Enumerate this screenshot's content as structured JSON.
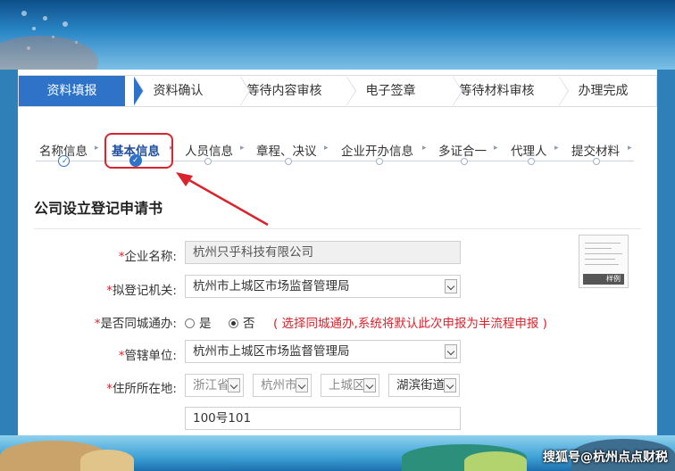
{
  "steps": [
    "资料填报",
    "资料确认",
    "等待内容审核",
    "电子签章",
    "等待材料审核",
    "办理完成"
  ],
  "substeps": [
    "名称信息",
    "基本信息",
    "人员信息",
    "章程、决议",
    "企业开办信息",
    "多证合一",
    "代理人",
    "提交材料"
  ],
  "form": {
    "title": "公司设立登记申请书",
    "company_name_label": "企业名称:",
    "company_name_value": "杭州只乎科技有限公司",
    "registry_label": "拟登记机关:",
    "registry_value": "杭州市上城区市场监督管理局",
    "same_city_label": "是否同城通办:",
    "radio_yes": "是",
    "radio_no": "否",
    "same_city_hint": "( 选择同城通办,系统将默认此次申报为半流程申报 )",
    "jurisdiction_label": "管辖单位:",
    "jurisdiction_value": "杭州市上城区市场监督管理局",
    "address_label": "住所所在地:",
    "province": "浙江省",
    "city": "杭州市",
    "district": "上城区",
    "street": "湖滨街道",
    "address_detail": "100号101",
    "required_mark": "*"
  },
  "sample_label": "样例",
  "watermark": "搜狐号@杭州点点财税",
  "colors": {
    "accent": "#2e73c7",
    "required": "#d9232d",
    "highlight": "#d9232d"
  }
}
